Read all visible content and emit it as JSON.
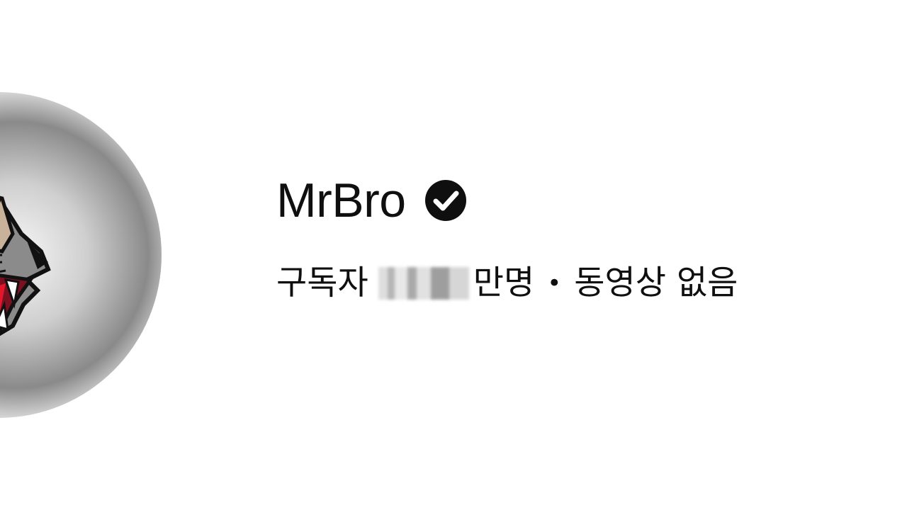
{
  "channel": {
    "name": "MrBro",
    "verified_icon": "verified-check-icon",
    "subscribers_label": "구독자",
    "subscriber_count_blurred": "",
    "subscriber_unit": "만명",
    "separator": "•",
    "videos_label": "동영상 없음"
  },
  "avatar": {
    "icon": "panther-logo-avatar"
  },
  "colors": {
    "text": "#0f0f0f",
    "background": "#ffffff",
    "accent_red": "#e3162b"
  }
}
